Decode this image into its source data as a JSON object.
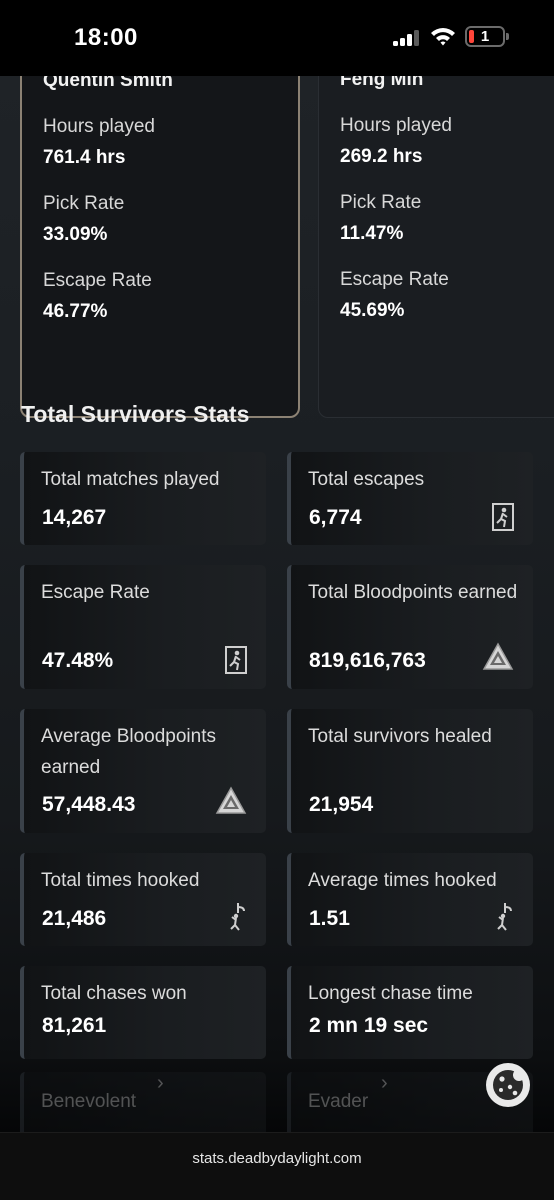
{
  "status": {
    "time": "18:00",
    "battery": "1"
  },
  "survivors": [
    {
      "name": "Quentin Smith",
      "hours_label": "Hours played",
      "hours": "761.4 hrs",
      "pick_label": "Pick Rate",
      "pick": "33.09%",
      "escape_label": "Escape Rate",
      "escape": "46.77%"
    },
    {
      "name": "Feng Min",
      "hours_label": "Hours played",
      "hours": "269.2 hrs",
      "pick_label": "Pick Rate",
      "pick": "11.47%",
      "escape_label": "Escape Rate",
      "escape": "45.69%"
    }
  ],
  "section_title": "Total Survivors Stats",
  "stats": [
    {
      "label": "Total matches played",
      "value": "14,267",
      "icon": ""
    },
    {
      "label": "Total escapes",
      "value": "6,774",
      "icon": "exit-door-icon"
    },
    {
      "label": "Escape Rate",
      "value": "47.48%",
      "icon": "exit-door-icon"
    },
    {
      "label": "Total Bloodpoints earned",
      "value": "819,616,763",
      "icon": "bloodpoints-icon"
    },
    {
      "label": "Average Bloodpoints earned",
      "value": "57,448.43",
      "icon": "bloodpoints-icon"
    },
    {
      "label": "Total survivors healed",
      "value": "21,954",
      "icon": ""
    },
    {
      "label": "Total times hooked",
      "value": "21,486",
      "icon": "hook-icon"
    },
    {
      "label": "Average times hooked",
      "value": "1.51",
      "icon": "hook-icon"
    },
    {
      "label": "Total chases won",
      "value": "81,261",
      "icon": ""
    },
    {
      "label": "Longest chase time",
      "value": "2 mn 19 sec",
      "icon": ""
    }
  ],
  "badges": [
    {
      "label": "Benevolent"
    },
    {
      "label": "Evader"
    }
  ],
  "url": "stats.deadbydaylight.com"
}
